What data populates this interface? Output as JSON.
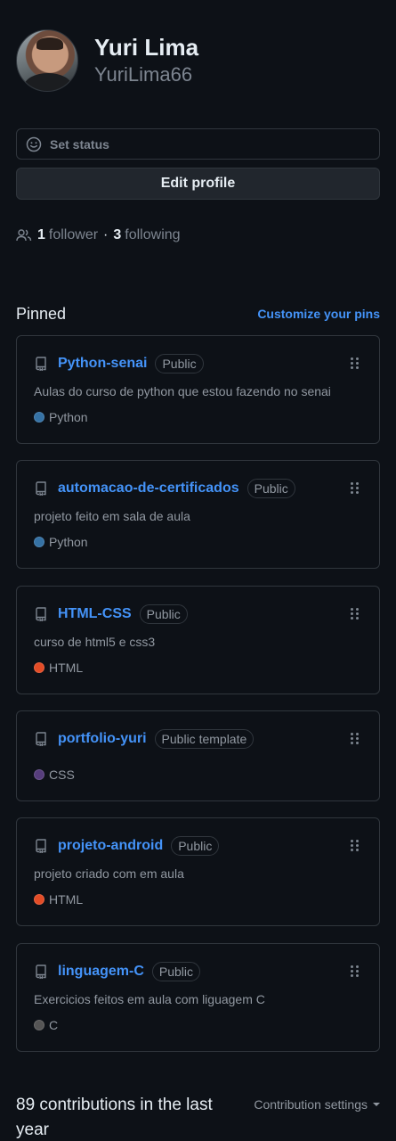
{
  "profile": {
    "full_name": "Yuri Lima",
    "login": "YuriLima66",
    "set_status_label": "Set status",
    "edit_profile_label": "Edit profile",
    "followers_count": "1",
    "followers_label": "follower",
    "separator": "·",
    "following_count": "3",
    "following_label": "following"
  },
  "pinned": {
    "title": "Pinned",
    "customize_label": "Customize your pins",
    "repos": [
      {
        "name": "Python-senai",
        "visibility": "Public",
        "description": "Aulas do curso de python que estou fazendo no senai",
        "language": "Python",
        "language_color": "#3572A5"
      },
      {
        "name": "automacao-de-certificados",
        "visibility": "Public",
        "description": "projeto feito em sala de aula",
        "language": "Python",
        "language_color": "#3572A5"
      },
      {
        "name": "HTML-CSS",
        "visibility": "Public",
        "description": "curso de html5 e css3",
        "language": "HTML",
        "language_color": "#e34c26"
      },
      {
        "name": "portfolio-yuri",
        "visibility": "Public template",
        "description": "",
        "language": "CSS",
        "language_color": "#563d7c"
      },
      {
        "name": "projeto-android",
        "visibility": "Public",
        "description": "projeto criado com em aula",
        "language": "HTML",
        "language_color": "#e34c26"
      },
      {
        "name": "linguagem-C",
        "visibility": "Public",
        "description": "Exercicios feitos em aula com liguagem C",
        "language": "C",
        "language_color": "#555555"
      }
    ]
  },
  "contributions": {
    "title": "89 contributions in the last year",
    "settings_label": "Contribution settings"
  },
  "colors": {
    "background": "#0d1117",
    "link": "#4493f8",
    "border": "#30363d",
    "muted": "#7d8590"
  }
}
